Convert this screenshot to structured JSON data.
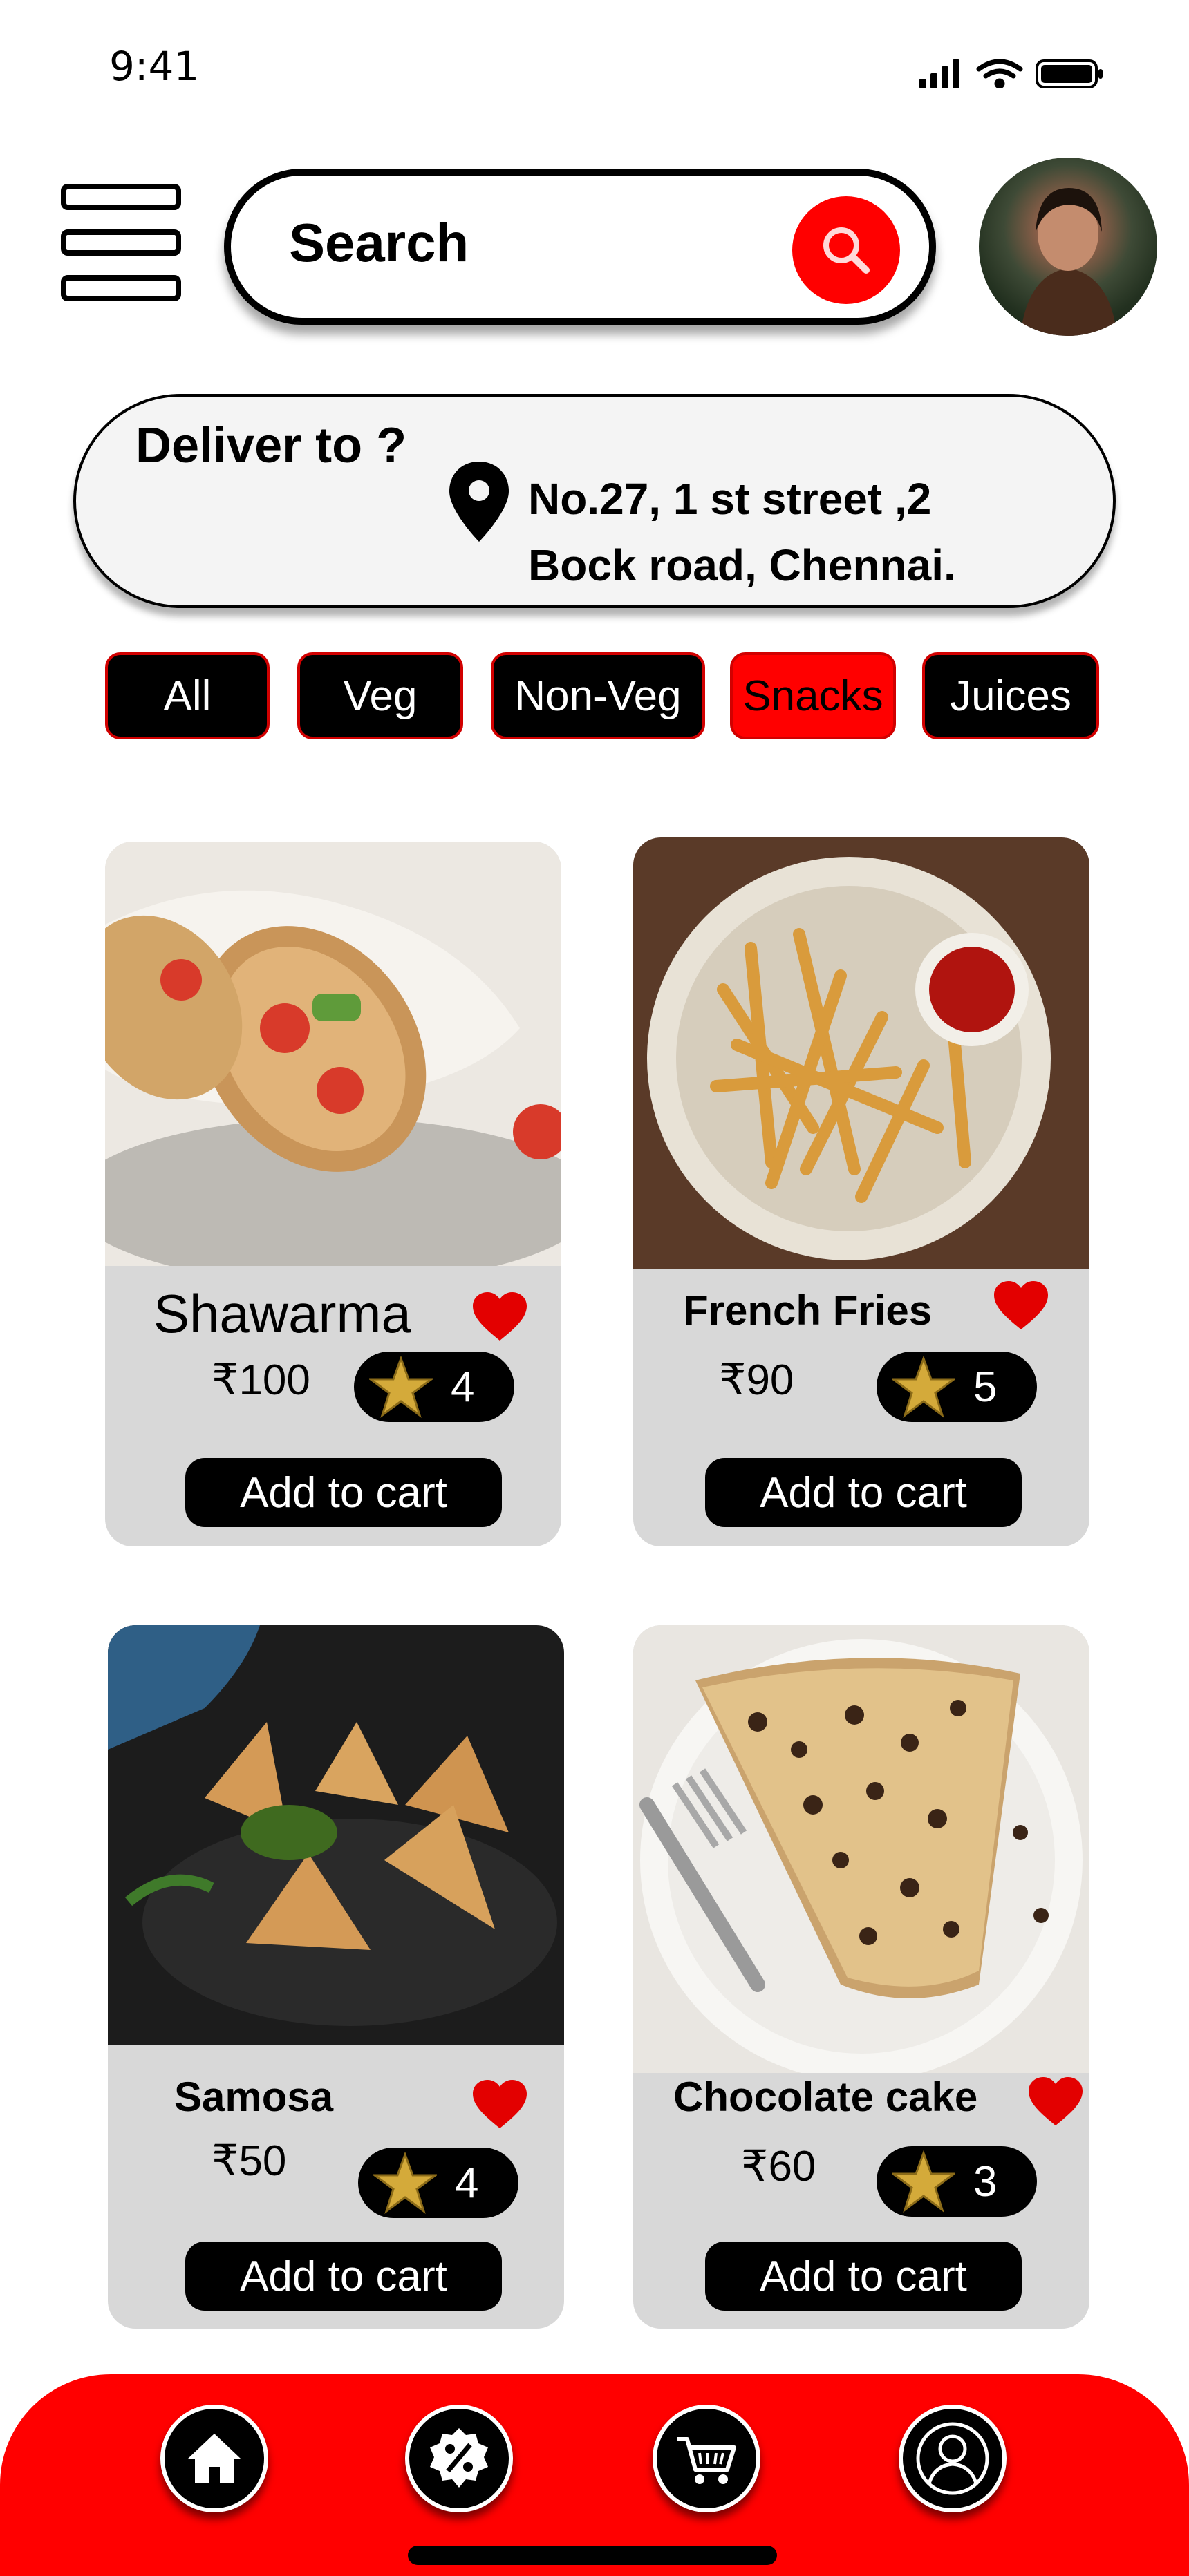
{
  "status_bar": {
    "time": "9:41",
    "icons": [
      "signal-icon",
      "wifi-icon",
      "battery-icon"
    ]
  },
  "header": {
    "menu_icon": "menu-icon",
    "search": {
      "placeholder": "Search",
      "icon": "search-icon"
    },
    "avatar_icon": "avatar"
  },
  "delivery": {
    "label": "Deliver to ?",
    "icon": "location-pin-icon",
    "address_line1": "No.27, 1 st street ,2",
    "address_line2": "Bock road, Chennai."
  },
  "categories": [
    {
      "label": "All",
      "active": false
    },
    {
      "label": "Veg",
      "active": false
    },
    {
      "label": "Non-Veg",
      "active": false
    },
    {
      "label": "Snacks",
      "active": true
    },
    {
      "label": "Juices",
      "active": false
    }
  ],
  "products": [
    {
      "name": "Shawarma",
      "price": "₹100",
      "rating": "4",
      "favorite": true,
      "button": "Add to cart"
    },
    {
      "name": "French Fries",
      "price": "₹90",
      "rating": "5",
      "favorite": true,
      "button": "Add to cart"
    },
    {
      "name": "Samosa",
      "price": "₹50",
      "rating": "4",
      "favorite": true,
      "button": "Add to cart"
    },
    {
      "name": "Chocolate cake",
      "price": "₹60",
      "rating": "3",
      "favorite": true,
      "button": "Add to cart"
    }
  ],
  "bottom_nav": [
    {
      "icon": "home-icon"
    },
    {
      "icon": "offers-percent-icon"
    },
    {
      "icon": "cart-icon"
    },
    {
      "icon": "profile-icon"
    }
  ],
  "colors": {
    "accent": "#ff0000",
    "card_bg": "#d8d8d8",
    "chip_bg": "#000000",
    "address_bg": "#f4f4f4"
  }
}
